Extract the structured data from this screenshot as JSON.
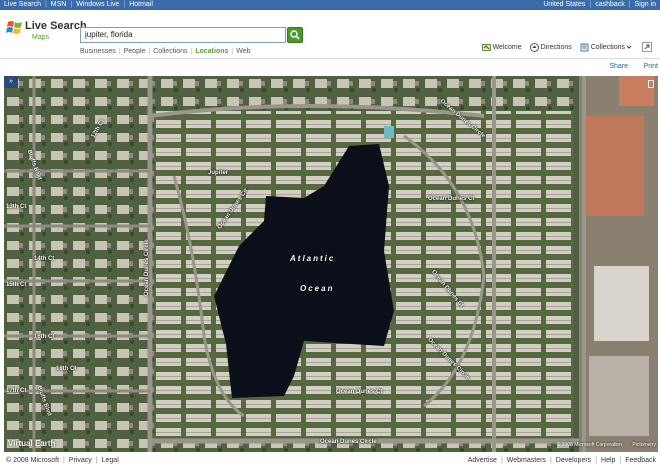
{
  "topbar": {
    "left_links": [
      "Live Search",
      "MSN",
      "Windows Live",
      "Hotmail"
    ],
    "right_links": [
      "United States",
      "cashback",
      "Sign in"
    ]
  },
  "header": {
    "logo_text": "Live Search",
    "logo_sub": "Maps",
    "search_value": "jupiter, florida",
    "scopes": [
      "Businesses",
      "People",
      "Collections",
      "Locations",
      "Web"
    ],
    "active_scope": "Locations",
    "tools": {
      "welcome": "Welcome",
      "directions": "Directions",
      "collections": "Collections"
    }
  },
  "sharebar": {
    "share": "Share",
    "print": "Print"
  },
  "map": {
    "handle_label": "»",
    "labels": {
      "jupiter": "Jupiter",
      "atlantic": "Atlantic",
      "ocean": "Ocean",
      "ocean_dunes_cir_left": "Ocean Dunes Circle",
      "ocean_dunes_cir_bottom": "Ocean Dunes Circle",
      "ocean_dunes_ct_bottom": "Ocean Dunes Ct",
      "ocean_dunes_top": "Ocean Dunes Circle",
      "ocean_dunes_ct_right": "Ocean Dunes Ct",
      "ocean_dunes_dr": "Ocean Dunes Ct",
      "jupiter_label_2": "Ocean Dunes Cir",
      "st_13th": "13th Ct",
      "st_14th": "14th Ct",
      "st_15th": "15th Ct",
      "st_16th": "16th Ct",
      "st_17th": "17th Ct",
      "st_18th": "18th Ct",
      "st_12th": "12th Ct",
      "bluffs_blvd_1": "Bluffs Blvd",
      "bluffs_blvd_2": "Bluffs Blvd",
      "ocean_left": "Ocean Dunes Circle"
    },
    "brand": "Virtual Earth",
    "copyright": "© 2008 Microsoft Corporation",
    "pictometry": "Pictometry"
  },
  "footer": {
    "left": [
      "© 2008 Microsoft",
      "Privacy",
      "Legal"
    ],
    "right": [
      "Advertise",
      "Webmasters",
      "Developers",
      "Help",
      "Feedback"
    ]
  },
  "colors": {
    "topbar": "#3c6ca8",
    "accent_green": "#5a9c2d",
    "link_blue": "#2a62b0",
    "water": "#0b0f1a"
  }
}
